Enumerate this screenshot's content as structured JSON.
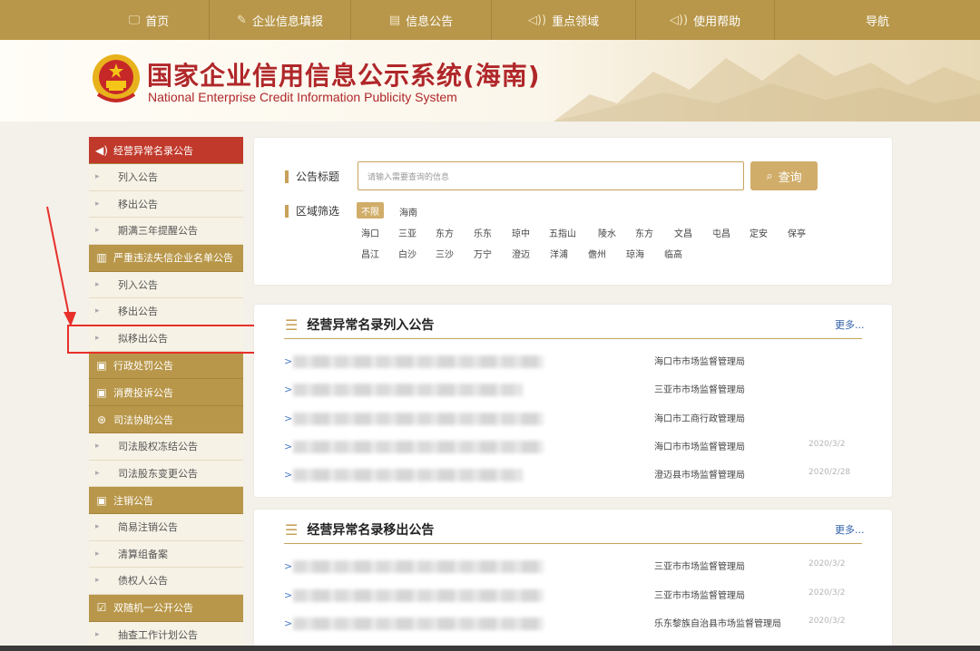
{
  "nav": {
    "items": [
      {
        "label": "首页",
        "icon": "monitor-icon"
      },
      {
        "label": "企业信息填报",
        "icon": "pen-icon"
      },
      {
        "label": "信息公告",
        "icon": "document-icon"
      },
      {
        "label": "重点领域",
        "icon": "speaker-icon"
      },
      {
        "label": "使用帮助",
        "icon": "speaker-icon"
      },
      {
        "label": "导航",
        "icon": ""
      }
    ]
  },
  "header": {
    "title_cn": "国家企业信用信息公示系统(海南)",
    "title_en": "National Enterprise Credit Information Publicity System"
  },
  "sidebar": {
    "sections": [
      {
        "label": "经营异常名录公告",
        "icon": "speaker-icon",
        "active": true,
        "items": [
          "列入公告",
          "移出公告",
          "期满三年提醒公告"
        ]
      },
      {
        "label": "严重违法失信企业名单公告",
        "icon": "book-icon",
        "items": [
          "列入公告",
          "移出公告",
          "拟移出公告"
        ]
      },
      {
        "label": "行政处罚公告",
        "icon": "doc-edit-icon",
        "items": []
      },
      {
        "label": "消费投诉公告",
        "icon": "doc-edit-icon",
        "items": []
      },
      {
        "label": "司法协助公告",
        "icon": "gear-circle-icon",
        "items": [
          "司法股权冻结公告",
          "司法股东变更公告"
        ]
      },
      {
        "label": "注销公告",
        "icon": "doc-edit-icon",
        "items": [
          "简易注销公告",
          "清算组备案",
          "债权人公告"
        ]
      },
      {
        "label": "双随机一公开公告",
        "icon": "check-box-icon",
        "items": [
          "抽查工作计划公告"
        ]
      }
    ]
  },
  "search": {
    "title_label": "公告标题",
    "placeholder": "请输入需要查询的信息",
    "button_label": "查询",
    "region_label": "区域筛选",
    "region_all": "不限",
    "region_row1_first": "海南",
    "regions_row2": [
      "海口",
      "三亚",
      "东方",
      "乐东",
      "琼中",
      "五指山",
      "陵水",
      "东方",
      "文昌",
      "屯昌",
      "定安",
      "保亭"
    ],
    "regions_row3": [
      "昌江",
      "白沙",
      "三沙",
      "万宁",
      "澄迈",
      "洋浦",
      "儋州",
      "琼海",
      "临高"
    ]
  },
  "panels": [
    {
      "title": "经营异常名录列入公告",
      "more": "更多...",
      "rows": [
        {
          "dept": "海口市市场监督管理局",
          "date": ""
        },
        {
          "dept": "三亚市市场监督管理局",
          "date": ""
        },
        {
          "dept": "海口市工商行政管理局",
          "date": ""
        },
        {
          "dept": "海口市市场监督管理局",
          "date": "2020/3/2"
        },
        {
          "dept": "澄迈县市场监督管理局",
          "date": "2020/2/28"
        }
      ]
    },
    {
      "title": "经营异常名录移出公告",
      "more": "更多...",
      "rows": [
        {
          "dept": "三亚市市场监督管理局",
          "date": "2020/3/2"
        },
        {
          "dept": "三亚市市场监督管理局",
          "date": "2020/3/2"
        },
        {
          "dept": "乐东黎族自治县市场监督管理局",
          "date": "2020/3/2"
        }
      ]
    }
  ],
  "colors": {
    "gold": "#b8974a",
    "accent": "#d1ad6a",
    "red": "#c0392b",
    "highlight": "#e8302a"
  }
}
